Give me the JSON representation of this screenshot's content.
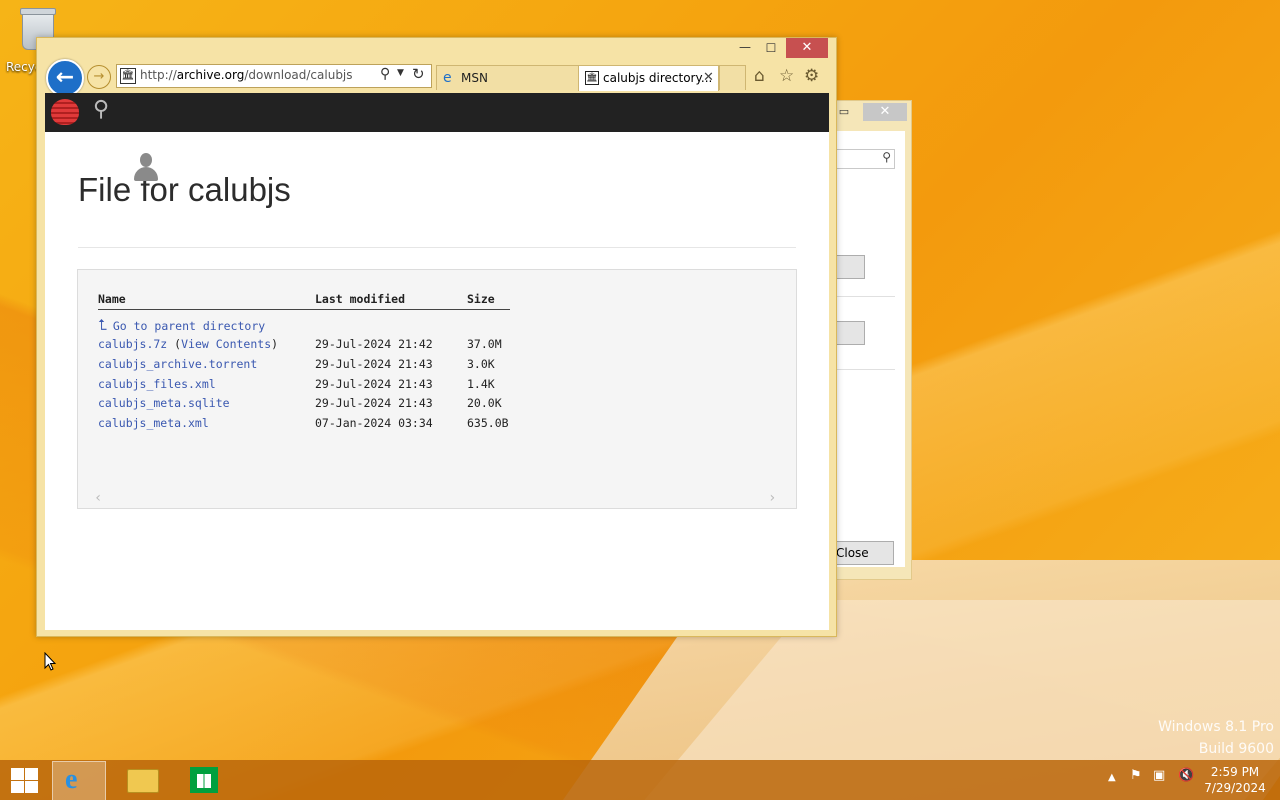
{
  "desktop": {
    "recycle_bin_label": "Recyc",
    "watermark_line1": "Windows 8.1 Pro",
    "watermark_line2": "Build 9600"
  },
  "background_dialog": {
    "maximize_glyph": "▭",
    "close_glyph": "✕",
    "search_icon_glyph": "⚲",
    "close_button_label": "Close"
  },
  "browser": {
    "minimize_glyph": "—",
    "maximize_glyph": "☐",
    "close_glyph": "✕",
    "back_glyph": "←",
    "forward_glyph": "→",
    "address": {
      "prefix": "http://",
      "domain": "archive.org",
      "path": "/download/calubjs"
    },
    "tabs": [
      {
        "label": "MSN"
      },
      {
        "label": "calubjs directory...",
        "close": "✕"
      }
    ],
    "toolbar_icons": [
      "home-icon",
      "favorites-star-icon",
      "gear-icon"
    ]
  },
  "page": {
    "title_prefix": "File",
    "title_suffix": " for calubjs",
    "columns": [
      "Name",
      "Last modified",
      "Size"
    ],
    "parent_link": "Go to parent directory",
    "rows": [
      {
        "name": "calubjs.7z",
        "extra_open": " (",
        "extra_link": "View Contents",
        "extra_close": ")",
        "modified": "29-Jul-2024 21:42",
        "size": "37.0M"
      },
      {
        "name": "calubjs_archive.torrent",
        "modified": "29-Jul-2024 21:43",
        "size": "3.0K"
      },
      {
        "name": "calubjs_files.xml",
        "modified": "29-Jul-2024 21:43",
        "size": "1.4K"
      },
      {
        "name": "calubjs_meta.sqlite",
        "modified": "29-Jul-2024 21:43",
        "size": "20.0K"
      },
      {
        "name": "calubjs_meta.xml",
        "modified": "07-Jan-2024 03:34",
        "size": "635.0B"
      }
    ]
  },
  "taskbar": {
    "time": "2:59 PM",
    "date": "7/29/2024"
  },
  "colors": {
    "link": "#3a58b0",
    "ie_frame": "#f6e3a6",
    "close_red": "#c75050"
  }
}
